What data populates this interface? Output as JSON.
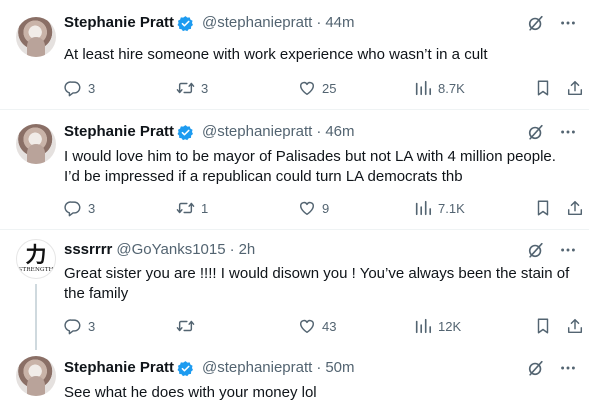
{
  "posts": [
    {
      "name": "Stephanie Pratt",
      "handle": "@stephaniepratt",
      "dot": "·",
      "time": "44m",
      "text": "At least hire someone with work experience who wasn’t in a cult",
      "replies": "3",
      "reposts": "3",
      "likes": "25",
      "views": "8.7K"
    },
    {
      "name": "Stephanie Pratt",
      "handle": "@stephaniepratt",
      "dot": "·",
      "time": "46m",
      "text": "I would love him to be mayor of Palisades but not LA with 4 million people.\nI’d be impressed if a republican could turn LA democrats thb",
      "replies": "3",
      "reposts": "1",
      "likes": "9",
      "views": "7.1K"
    },
    {
      "name": "sssrrrr",
      "handle": "@GoYanks1015",
      "dot": "·",
      "time": "2h",
      "avatar_glyph": "力",
      "avatar_word": "STRENGTH",
      "text": "Great sister you are !!!! I would disown you ! You’ve always been the stain of\nthe family",
      "replies": "3",
      "reposts": "",
      "likes": "43",
      "views": "12K"
    },
    {
      "name": "Stephanie Pratt",
      "handle": "@stephaniepratt",
      "dot": "·",
      "time": "50m",
      "text": "See what he does with your money lol"
    }
  ],
  "icons": {
    "verified": "verified-badge-icon",
    "grok": "grok-icon",
    "more": "more-icon",
    "reply": "reply-icon",
    "repost": "repost-icon",
    "like": "like-icon",
    "views": "views-icon",
    "bookmark": "bookmark-icon",
    "share": "share-icon"
  },
  "colors": {
    "text": "#0f1419",
    "secondary": "#536471",
    "verified": "#1d9bf0",
    "divider": "#eff3f4",
    "thread_line": "#cfd9de"
  }
}
